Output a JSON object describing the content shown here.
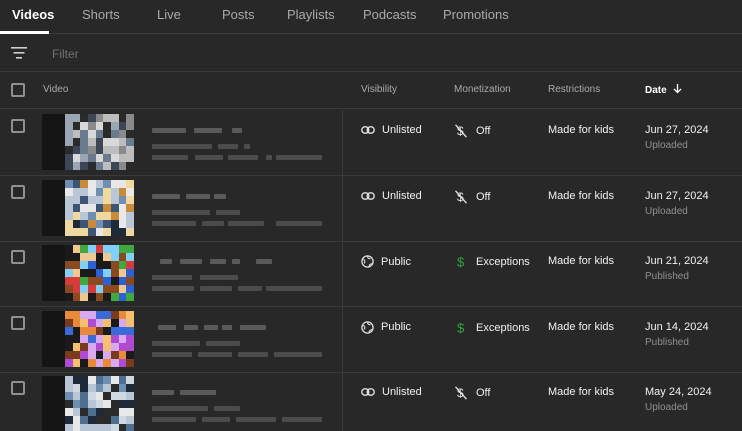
{
  "tabs": [
    {
      "label": "Videos",
      "active": true
    },
    {
      "label": "Shorts"
    },
    {
      "label": "Live"
    },
    {
      "label": "Posts"
    },
    {
      "label": "Playlists"
    },
    {
      "label": "Podcasts"
    },
    {
      "label": "Promotions"
    }
  ],
  "filter": {
    "placeholder": "Filter",
    "icon": "filter-icon"
  },
  "columns": {
    "video": "Video",
    "visibility": "Visibility",
    "monetization": "Monetization",
    "restrictions": "Restrictions",
    "date": "Date",
    "date_sort_icon": "arrow-down-icon"
  },
  "colors": {
    "background": "#282828",
    "divider": "#3a3a3a",
    "text_secondary": "#aaaaaa",
    "monetization_on": "#2ba640"
  },
  "rows": [
    {
      "visibility": "Unlisted",
      "visibility_icon": "link-icon",
      "monetization": "Off",
      "monetization_icon": "dollar-off-icon",
      "restrictions": "Made for kids",
      "date": "Jun 27, 2024",
      "date_status": "Uploaded",
      "thumb_palette": [
        "#2a2a2a",
        "#8a8a8a",
        "#bdbdbd",
        "#3c4656",
        "#9aa6b4",
        "#6b7b8f",
        "#d8d8d8"
      ]
    },
    {
      "visibility": "Unlisted",
      "visibility_icon": "link-icon",
      "monetization": "Off",
      "monetization_icon": "dollar-off-icon",
      "restrictions": "Made for kids",
      "date": "Jun 27, 2024",
      "date_status": "Uploaded",
      "thumb_palette": [
        "#1e2a3a",
        "#b8c6d6",
        "#e8e8e8",
        "#c98a3c",
        "#6f8fb0",
        "#3b5573",
        "#f0d9a0"
      ]
    },
    {
      "visibility": "Public",
      "visibility_icon": "globe-icon",
      "monetization": "Exceptions",
      "monetization_icon": "dollar-icon",
      "restrictions": "Made for kids",
      "date": "Jun 21, 2024",
      "date_status": "Published",
      "thumb_palette": [
        "#3fa83f",
        "#d83a3a",
        "#2d5fd6",
        "#8a4a1e",
        "#f0c890",
        "#1a1a1a",
        "#7fd0ff"
      ]
    },
    {
      "visibility": "Public",
      "visibility_icon": "globe-icon",
      "monetization": "Exceptions",
      "monetization_icon": "dollar-icon",
      "restrictions": "Made for kids",
      "date": "Jun 14, 2024",
      "date_status": "Published",
      "thumb_palette": [
        "#b04ad0",
        "#e88a3a",
        "#3a6ad8",
        "#7a3a1e",
        "#f4c070",
        "#d8a8f0",
        "#1a1a1a"
      ]
    },
    {
      "visibility": "Unlisted",
      "visibility_icon": "link-icon",
      "monetization": "Off",
      "monetization_icon": "dollar-off-icon",
      "restrictions": "Made for kids",
      "date": "May 24, 2024",
      "date_status": "Uploaded",
      "thumb_palette": [
        "#1e2a3a",
        "#b8c6d6",
        "#e8e8e8",
        "#4f6f90",
        "#6f8fb0",
        "#2a2a2a",
        "#d0d8e0"
      ]
    }
  ]
}
